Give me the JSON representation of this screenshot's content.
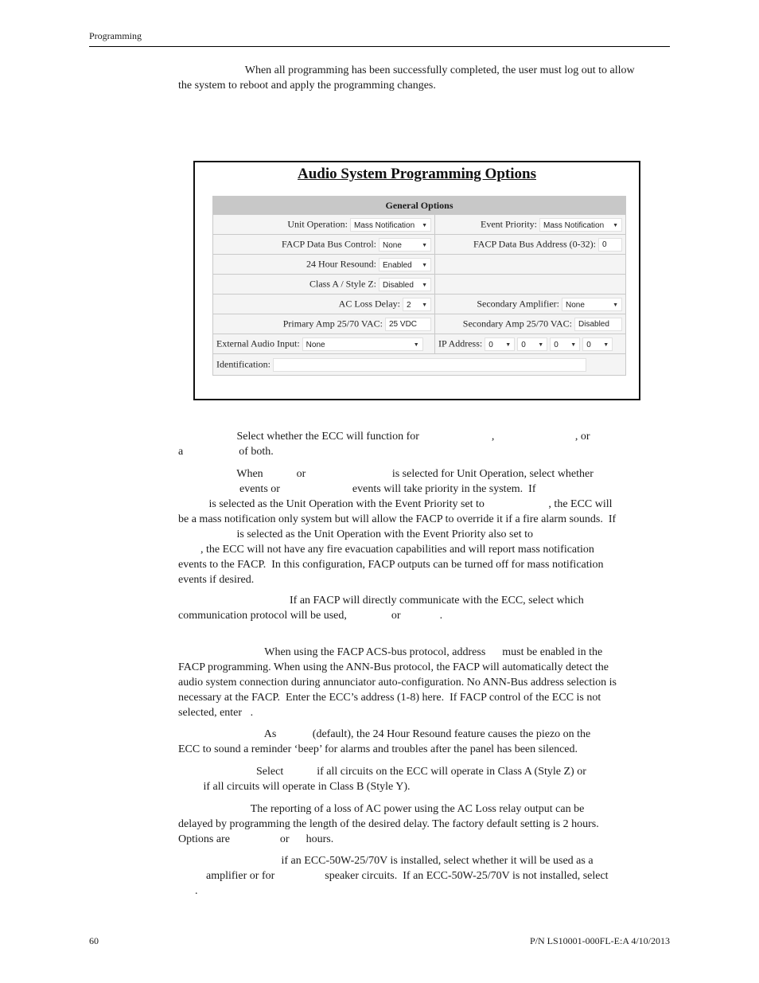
{
  "header": {
    "section": "Programming"
  },
  "intro": {
    "lines": [
      "                        When all programming has been successfully completed, the user must log out to allow",
      "the system to reboot and apply the programming changes."
    ]
  },
  "figure": {
    "title": "Audio System Programming Options",
    "section_header": "General Options",
    "fields": {
      "unit_operation": {
        "label": "Unit Operation:",
        "value": "Mass Notification"
      },
      "event_priority": {
        "label": "Event Priority:",
        "value": "Mass Notification"
      },
      "facp_bus_control": {
        "label": "FACP Data Bus Control:",
        "value": "None"
      },
      "facp_bus_address": {
        "label": "FACP Data Bus Address (0-32):",
        "value": "0"
      },
      "resound_24h": {
        "label": "24 Hour Resound:",
        "value": "Enabled"
      },
      "class_a_style_z": {
        "label": "Class A / Style Z:",
        "value": "Disabled"
      },
      "ac_loss_delay": {
        "label": "AC Loss Delay:",
        "value": "2"
      },
      "secondary_amplifier": {
        "label": "Secondary Amplifier:",
        "value": "None"
      },
      "primary_amp": {
        "label": "Primary Amp 25/70 VAC:",
        "value": "25 VDC"
      },
      "secondary_amp": {
        "label": "Secondary Amp 25/70 VAC:",
        "value": "Disabled"
      },
      "external_audio_input": {
        "label": "External Audio Input:",
        "value": "None"
      },
      "ip_address": {
        "label": "IP Address:",
        "octets": [
          "0",
          "0",
          "0",
          "0"
        ]
      },
      "identification": {
        "label": "Identification:",
        "value": ""
      }
    },
    "dropdown_arrow": "▼"
  },
  "body_paragraphs": [
    {
      "top": 0,
      "lines": [
        "                     Select whether the ECC will function for                          ,                             , or",
        "a                    of both."
      ]
    },
    {
      "lines": [
        "                     When            or                               is selected for Unit Operation, select whether",
        "                      events or                          events will take priority in the system.  If",
        "           is selected as the Unit Operation with the Event Priority set to                       , the ECC will",
        "be a mass notification only system but will allow the FACP to override it if a fire alarm sounds.  If",
        "                     is selected as the Unit Operation with the Event Priority also set to",
        "        , the ECC will not have any fire evacuation capabilities and will report mass notification",
        "events to the FACP.  In this configuration, FACP outputs can be turned off for mass notification",
        "events if desired."
      ]
    },
    {
      "lines": [
        "                                        If an FACP will directly communicate with the ECC, select which",
        "communication protocol will be used,                or              ."
      ]
    },
    {
      "lines": [
        "                               When using the FACP ACS-bus protocol, address      must be enabled in the",
        "FACP programming. When using the ANN-Bus protocol, the FACP will automatically detect the",
        "audio system connection during annunciator auto-configuration. No ANN-Bus address selection is",
        "necessary at the FACP.  Enter the ECC’s address (1-8) here.  If FACP control of the ECC is not",
        "selected, enter   ."
      ]
    },
    {
      "lines": [
        "                               As             (default), the 24 Hour Resound feature causes the piezo on the",
        "ECC to sound a reminder ‘beep’ for alarms and troubles after the panel has been silenced."
      ]
    },
    {
      "lines": [
        "                            Select            if all circuits on the ECC will operate in Class A (Style Z) or",
        "         if all circuits will operate in Class B (Style Y)."
      ]
    },
    {
      "lines": [
        "                          The reporting of a loss of AC power using the AC Loss relay output can be",
        "delayed by programming the length of the desired delay. The factory default setting is 2 hours.",
        "Options are                  or      hours."
      ]
    },
    {
      "lines": [
        "                                     if an ECC-50W-25/70V is installed, select whether it will be used as a",
        "          amplifier or for                  speaker circuits.  If an ECC-50W-25/70V is not installed, select",
        "      ."
      ]
    }
  ],
  "footer": {
    "page_number": "60",
    "doc_ref": "P/N LS10001-000FL-E:A  4/10/2013"
  }
}
